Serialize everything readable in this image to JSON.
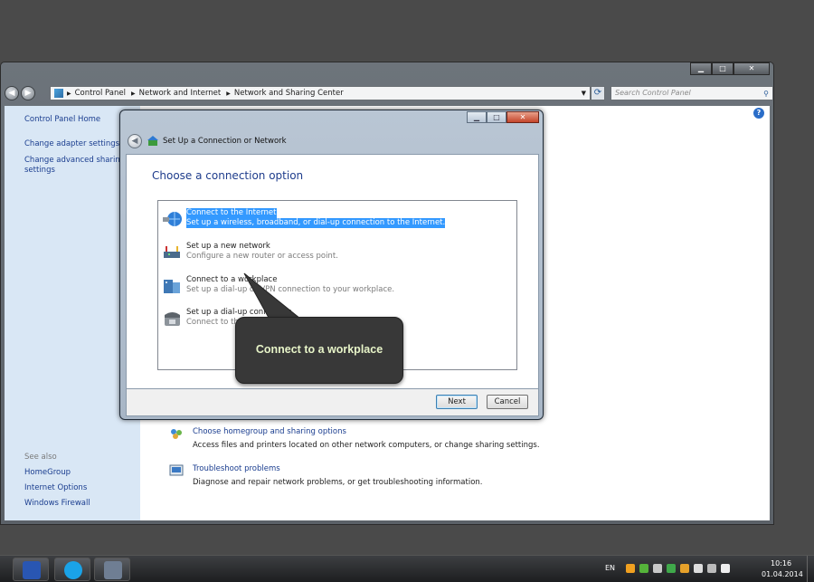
{
  "explorer": {
    "breadcrumb": [
      "Control Panel",
      "Network and Internet",
      "Network and Sharing Center"
    ],
    "search_placeholder": "Search Control Panel",
    "left_pane": {
      "home": "Control Panel Home",
      "links": [
        "Change adapter settings",
        "Change advanced sharing settings"
      ],
      "see_also_title": "See also",
      "see_also": [
        "HomeGroup",
        "Internet Options",
        "Windows Firewall"
      ]
    },
    "tasks": [
      {
        "link": "Choose homegroup and sharing options",
        "desc": "Access files and printers located on other network computers, or change sharing settings."
      },
      {
        "link": "Troubleshoot problems",
        "desc": "Diagnose and repair network problems, or get troubleshooting information."
      }
    ]
  },
  "wizard": {
    "title": "Set Up a Connection or Network",
    "heading": "Choose a connection option",
    "options": [
      {
        "title": "Connect to the Internet",
        "desc": "Set up a wireless, broadband, or dial-up connection to the Internet.",
        "selected": true
      },
      {
        "title": "Set up a new network",
        "desc": "Configure a new router or access point."
      },
      {
        "title": "Connect to a workplace",
        "desc": "Set up a dial-up or VPN connection to your workplace."
      },
      {
        "title": "Set up a dial-up connection",
        "desc": "Connect to the Internet using a dial-up connection."
      }
    ],
    "next_label": "Next",
    "cancel_label": "Cancel"
  },
  "callout": {
    "text": "Connect to a workplace"
  },
  "taskbar": {
    "apps": [
      "save-icon",
      "skype-icon",
      "virtualbox-icon"
    ],
    "language": "EN",
    "time": "10:16",
    "date": "01.04.2014"
  },
  "colors": {
    "selection": "#3399ff",
    "link": "#1a3d8f",
    "heading": "#1e3c8c",
    "callout_text": "#e7f4c8"
  }
}
